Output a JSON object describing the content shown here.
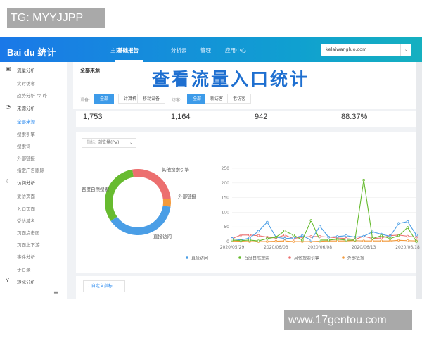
{
  "watermarks": {
    "top": "TG: MYYJJPP",
    "bottom": "www.17gentou.com"
  },
  "header": {
    "logo": "Bai du 统计",
    "nav": [
      "主页",
      "基础报告",
      "分析云",
      "管理",
      "应用中心"
    ],
    "active_nav": "基础报告",
    "site_select": "kelaiwangluo.com"
  },
  "sidebar": {
    "groups": [
      {
        "label": "流量分析",
        "icon": "monitor-icon",
        "items": [
          "实时访客",
          "趋势分析 今 昨"
        ]
      },
      {
        "label": "来源分析",
        "icon": "pie-icon",
        "items": [
          "全部来源",
          "搜索引擎",
          "搜索词",
          "外部链接",
          "指定广告跟踪"
        ]
      },
      {
        "label": "访问分析",
        "icon": "moon-icon",
        "items": [
          "受访页面",
          "入口页面",
          "受访域名",
          "页面点击图",
          "页面上下游",
          "事件分析",
          "子目录"
        ]
      },
      {
        "label": "转化分析",
        "icon": "funnel-icon",
        "items": []
      }
    ],
    "active_item": "全部来源"
  },
  "main": {
    "title": "全部来源",
    "overlay_caption": "查看流量入口统计",
    "device_label": "设备:",
    "device_options": [
      "全部",
      "计算机",
      "移动设备"
    ],
    "visitor_label": "访客:",
    "visitor_options": [
      "全部",
      "新访客",
      "老访客"
    ],
    "metrics": [
      "1,753",
      "1,164",
      "942",
      "88.37%"
    ],
    "metric_select": {
      "label": "指标:",
      "value": "浏览量(PV)"
    },
    "custom_metric_button": "自定义指标"
  },
  "colors": {
    "direct": "#4a9ee6",
    "baidu": "#67bb2f",
    "other": "#ec6f6f",
    "external": "#f39a3c"
  },
  "chart_data": [
    {
      "type": "pie",
      "donut": true,
      "slices": [
        {
          "name": "其他搜索引擎",
          "value": 26
        },
        {
          "name": "外部链接",
          "value": 4
        },
        {
          "name": "直接访问",
          "value": 38
        },
        {
          "name": "百度自然搜索",
          "value": 32
        }
      ]
    },
    {
      "type": "line",
      "x": [
        "2020/05/29",
        "2020/05/30",
        "2020/05/31",
        "2020/06/01",
        "2020/06/02",
        "2020/06/03",
        "2020/06/04",
        "2020/06/05",
        "2020/06/06",
        "2020/06/07",
        "2020/06/08",
        "2020/06/09",
        "2020/06/10",
        "2020/06/11",
        "2020/06/12",
        "2020/06/13",
        "2020/06/14",
        "2020/06/15",
        "2020/06/16",
        "2020/06/17",
        "2020/06/18",
        "2020/06/19"
      ],
      "xticks": [
        "2020/05/29",
        "2020/06/03",
        "2020/06/08",
        "2020/06/13",
        "2020/06/18"
      ],
      "yticks": [
        0,
        50,
        100,
        150,
        200,
        250
      ],
      "ylim": [
        0,
        250
      ],
      "grid": true,
      "legend": "bottom",
      "series": [
        {
          "name": "直接访问",
          "values": [
            10,
            5,
            12,
            35,
            66,
            15,
            10,
            12,
            20,
            5,
            52,
            15,
            17,
            20,
            15,
            18,
            33,
            25,
            18,
            62,
            68,
            22
          ]
        },
        {
          "name": "百度自然搜索",
          "values": [
            5,
            3,
            5,
            2,
            10,
            15,
            36,
            22,
            5,
            72,
            5,
            5,
            8,
            5,
            5,
            210,
            10,
            20,
            10,
            20,
            48,
            0
          ]
        },
        {
          "name": "其他搜索引擎",
          "values": [
            10,
            22,
            22,
            20,
            15,
            12,
            22,
            10,
            15,
            17,
            17,
            15,
            12,
            10,
            7,
            18,
            10,
            12,
            20,
            22,
            18,
            15
          ]
        },
        {
          "name": "外部链接",
          "values": [
            2,
            1,
            0,
            0,
            0,
            1,
            2,
            0,
            0,
            0,
            1,
            2,
            2,
            2,
            3,
            2,
            2,
            2,
            2,
            4,
            3,
            2
          ]
        }
      ]
    }
  ]
}
